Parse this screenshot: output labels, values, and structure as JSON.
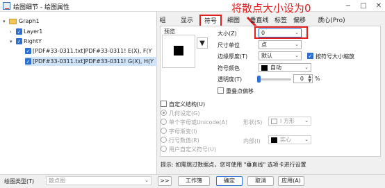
{
  "window": {
    "title": "绘图细节 - 绘图属性",
    "minimize": "−",
    "maximize": "□",
    "close": "✕"
  },
  "tree": [
    {
      "label": "Graph1",
      "type": "folder"
    },
    {
      "label": "Layer1",
      "type": "layer"
    },
    {
      "label": "RightY",
      "type": "layer"
    },
    {
      "label": "[PDF#33-0311.txt]PDF#33-0311! E(X), F(Y",
      "type": "plot"
    },
    {
      "label": "[PDF#33-0311.txt]PDF#33-0311! G(X), H(Y",
      "type": "plot"
    }
  ],
  "tabs": [
    "组",
    "显示",
    "符号",
    "细图",
    "垂直线",
    "标签",
    "偏移",
    "质心(Pro)"
  ],
  "annotation": "将散点大小设为0",
  "symbol": {
    "preview_label": "预览",
    "marker_button": "▼",
    "size_label": "大小(Z)",
    "size_value": "0",
    "size_unit_label": "尺寸单位",
    "size_unit_value": "点",
    "edge_label": "边缘厚度(T)",
    "edge_value": "默认",
    "scale_label": "按符号大小缩放",
    "color_label": "符号颜色",
    "color_value": "自动",
    "transparency_label": "透明度(T)",
    "transparency_value": "0",
    "transparency_unit": "%",
    "transparency_fill": 0,
    "overlap_label": "重叠点偏移"
  },
  "custom": {
    "label": "自定义结构(U)",
    "options": [
      "几何设定(G)",
      "单个字母或Unicode(A)",
      "字母渐变(I)",
      "行号数值(R)",
      "用户自定义符号(U)"
    ],
    "shape_label": "形状(S)",
    "shape_value": "I 方形",
    "interior_label": "内部(I)",
    "interior_value": "实心"
  },
  "hint": "提示: 如需跳过数据点，您可使用 \"垂直线\" 选项卡进行设置",
  "bottom": {
    "plot_type_label": "绘图类型(T)",
    "plot_type_value": "散点图",
    "nav": ">>",
    "workbook": "工作簿",
    "ok": "确定",
    "cancel": "取消",
    "apply": "应用(A)"
  },
  "colors": {
    "accent": "#2f6fd0",
    "highlight": "#e02020"
  }
}
